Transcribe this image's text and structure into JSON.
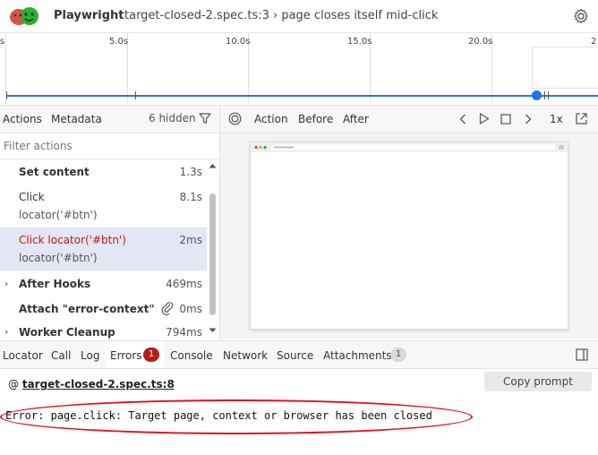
{
  "header": {
    "app_name": "Playwright",
    "title": "target-closed-2.spec.ts:3 › page closes itself mid-click"
  },
  "timeline": {
    "ticks": [
      "s",
      "5.0s",
      "10.0s",
      "15.0s",
      "20.0s",
      "2"
    ]
  },
  "left_panel": {
    "tabs": [
      "Actions",
      "Metadata"
    ],
    "hidden_label": "6 hidden",
    "filter_placeholder": "Filter actions",
    "actions": [
      {
        "title": "Set content",
        "time": "1.3s"
      },
      {
        "title": "Click",
        "subtitle": "locator('#btn')",
        "time": "8.1s"
      },
      {
        "title": "Click locator('#btn')",
        "subtitle": "locator('#btn')",
        "time": "2ms"
      },
      {
        "title": "After Hooks",
        "time": "469ms"
      },
      {
        "title": "Attach \"error-context\"",
        "time": "0ms"
      },
      {
        "title": "Worker Cleanup",
        "time": "794ms"
      }
    ]
  },
  "right_panel": {
    "tabs": [
      "Action",
      "Before",
      "After"
    ],
    "speed": "1x"
  },
  "bottom_tabs": [
    {
      "label": "Locator"
    },
    {
      "label": "Call"
    },
    {
      "label": "Log"
    },
    {
      "label": "Errors",
      "badge": "1"
    },
    {
      "label": "Console"
    },
    {
      "label": "Network"
    },
    {
      "label": "Source"
    },
    {
      "label": "Attachments",
      "badge": "1"
    }
  ],
  "errors": {
    "location_prefix": "@",
    "location_link": "target-closed-2.spec.ts:8",
    "copy_button": "Copy prompt",
    "message": "Error: page.click: Target page, context or browser has been closed"
  },
  "colors": {
    "accent": "#1a73e8",
    "selected_row": "#e3e6f3",
    "error_title": "#b71c1c",
    "error_badge": "#b71c1c",
    "highlight": "#e0131a"
  },
  "icons": [
    "playwright-logo",
    "gear-icon",
    "filter-icon",
    "target-icon",
    "prev-icon",
    "play-icon",
    "stop-icon",
    "next-icon",
    "open-external-icon",
    "paperclip-icon",
    "split-icon"
  ]
}
